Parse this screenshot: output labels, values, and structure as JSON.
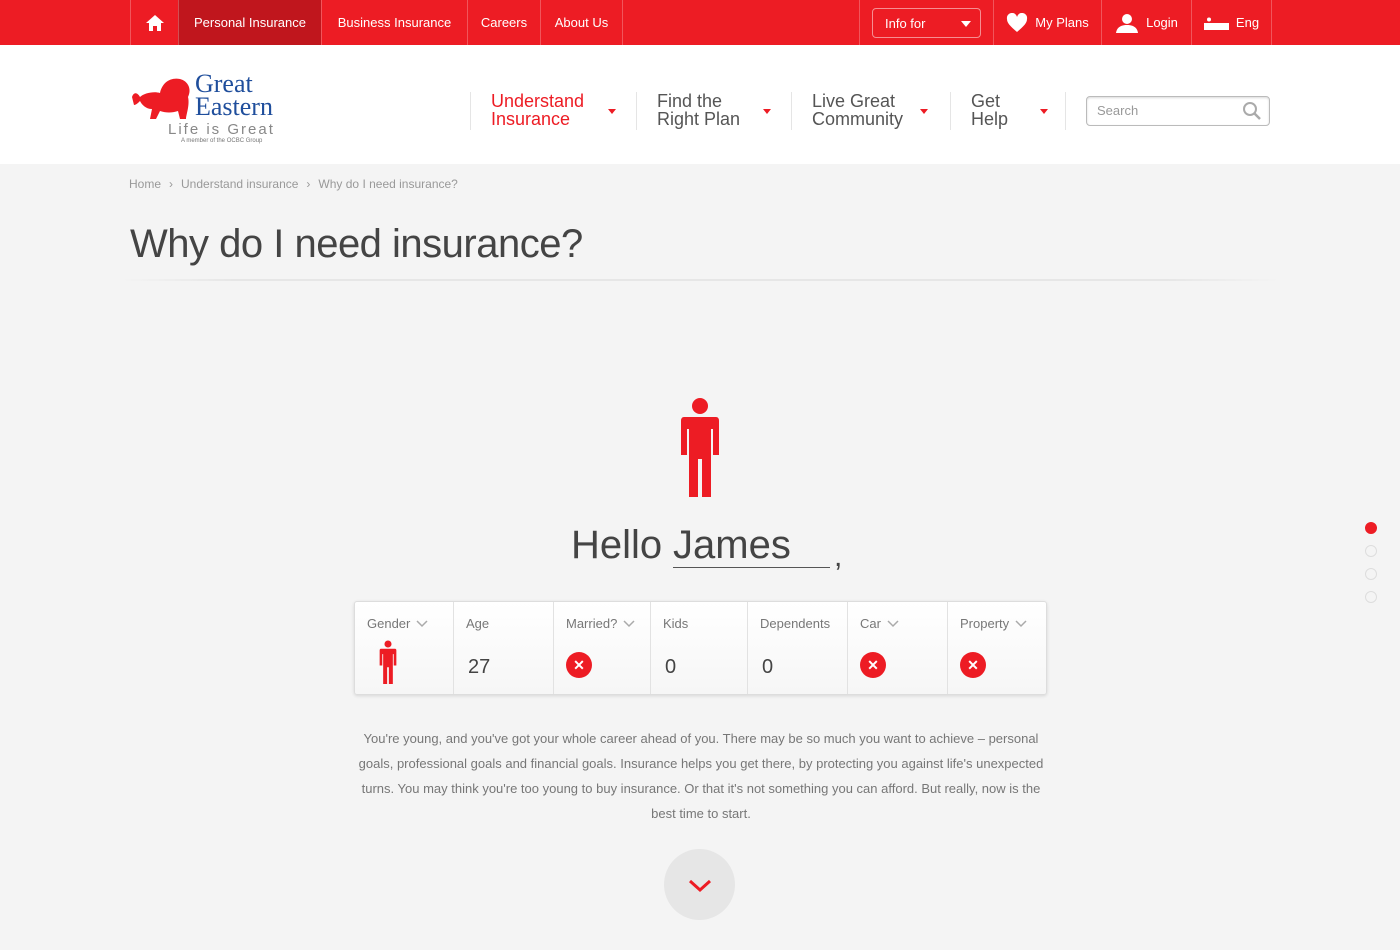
{
  "topbar": {
    "home_icon": "house-icon",
    "items": [
      {
        "label": "Personal Insurance",
        "active": true
      },
      {
        "label": "Business Insurance"
      },
      {
        "label": "Careers"
      },
      {
        "label": "About Us"
      }
    ],
    "info_for": "Info for",
    "my_plans": "My Plans",
    "login": "Login",
    "language": "Eng"
  },
  "logo": {
    "line1": "Great",
    "line2": "Eastern",
    "tagline": "Life is Great",
    "member": "A member of the OCBC Group"
  },
  "nav": [
    {
      "line1": "Understand",
      "line2": "Insurance",
      "active": true
    },
    {
      "line1": "Find the",
      "line2": "Right Plan"
    },
    {
      "line1": "Live Great",
      "line2": "Community"
    },
    {
      "line1": "Get",
      "line2": "Help"
    }
  ],
  "search": {
    "placeholder": "Search",
    "value": ""
  },
  "breadcrumb": [
    "Home",
    "Understand insurance",
    "Why do I need insurance?"
  ],
  "page_title": "Why do I need insurance?",
  "greeting": {
    "hello": "Hello",
    "name": "James",
    "comma": ","
  },
  "profile": {
    "gender": {
      "label": "Gender",
      "value": "male"
    },
    "age": {
      "label": "Age",
      "value": "27"
    },
    "married": {
      "label": "Married?",
      "value": false
    },
    "kids": {
      "label": "Kids",
      "value": "0"
    },
    "dependents": {
      "label": "Dependents",
      "value": "0"
    },
    "car": {
      "label": "Car",
      "value": false
    },
    "property": {
      "label": "Property",
      "value": false
    },
    "no_symbol": "✕"
  },
  "description": "You're young, and you've got your whole career ahead of you. There may be so much you want to achieve – personal goals, professional goals and financial goals. Insurance helps you get there, by protecting you against life's unexpected turns. You may think you're too young to buy insurance. Or that it's not something you can afford. But really, now is the best time to start.",
  "pager": {
    "total": 4,
    "current": 1
  },
  "colors": {
    "brand_red": "#ed1c24",
    "active_tab": "#c0161d",
    "logo_blue": "#1f4e9c"
  }
}
